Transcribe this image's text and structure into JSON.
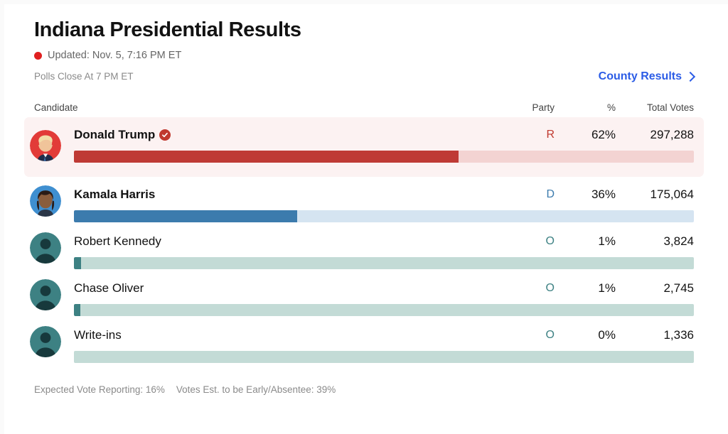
{
  "header": {
    "title": "Indiana Presidential Results",
    "updated": "Updated: Nov. 5, 7:16 PM ET",
    "polls_close": "Polls Close At 7 PM ET",
    "county_link": "County Results",
    "live_dot_color": "#e02020",
    "link_color": "#2b5ce6"
  },
  "table": {
    "columns": {
      "candidate": "Candidate",
      "party": "Party",
      "percent": "%",
      "total_votes": "Total Votes"
    },
    "rows": [
      {
        "name": "Donald Trump",
        "party": "R",
        "percent": "62%",
        "votes": "297,288",
        "bar_pct": 62,
        "winner": true,
        "avatar": "donald-trump-photo",
        "bar_color": "#bf3a35",
        "track_color": "#f3d3d2",
        "row_bg": "#fcf2f2"
      },
      {
        "name": "Kamala Harris",
        "party": "D",
        "percent": "36%",
        "votes": "175,064",
        "bar_pct": 36,
        "winner": false,
        "avatar": "kamala-harris-photo",
        "bar_color": "#3c7bad",
        "track_color": "#d5e4f1",
        "row_bg": "#ffffff"
      },
      {
        "name": "Robert Kennedy",
        "party": "O",
        "percent": "1%",
        "votes": "3,824",
        "bar_pct": 1.1,
        "winner": false,
        "avatar": "generic-person-silhouette",
        "bar_color": "#3d8183",
        "track_color": "#c3dbd6",
        "row_bg": "#ffffff"
      },
      {
        "name": "Chase Oliver",
        "party": "O",
        "percent": "1%",
        "votes": "2,745",
        "bar_pct": 1.0,
        "winner": false,
        "avatar": "generic-person-silhouette",
        "bar_color": "#3d8183",
        "track_color": "#c3dbd6",
        "row_bg": "#ffffff"
      },
      {
        "name": "Write-ins",
        "party": "O",
        "percent": "0%",
        "votes": "1,336",
        "bar_pct": 0,
        "winner": false,
        "avatar": "generic-person-silhouette",
        "bar_color": "#3d8183",
        "track_color": "#c3dbd6",
        "row_bg": "#ffffff"
      }
    ]
  },
  "footer": {
    "expected_vote": "Expected Vote Reporting: 16%",
    "early_absentee": "Votes Est. to be Early/Absentee: 39%"
  },
  "chart_data": {
    "type": "bar",
    "title": "Indiana Presidential Results",
    "categories": [
      "Donald Trump",
      "Kamala Harris",
      "Robert Kennedy",
      "Chase Oliver",
      "Write-ins"
    ],
    "series": [
      {
        "name": "Percent of vote",
        "values": [
          62,
          36,
          1,
          1,
          0
        ]
      },
      {
        "name": "Total votes",
        "values": [
          297288,
          175064,
          3824,
          2745,
          1336
        ]
      }
    ],
    "parties": [
      "R",
      "D",
      "O",
      "O",
      "O"
    ],
    "colors": [
      "#bf3a35",
      "#3c7bad",
      "#3d8183",
      "#3d8183",
      "#3d8183"
    ],
    "xlabel": "",
    "ylabel": "",
    "ylim": [
      0,
      100
    ],
    "grid": false,
    "legend": "none",
    "annotations": [
      "Expected Vote Reporting: 16%",
      "Votes Est. to be Early/Absentee: 39%",
      "Updated: Nov. 5, 7:16 PM ET",
      "Polls Close At 7 PM ET"
    ]
  }
}
